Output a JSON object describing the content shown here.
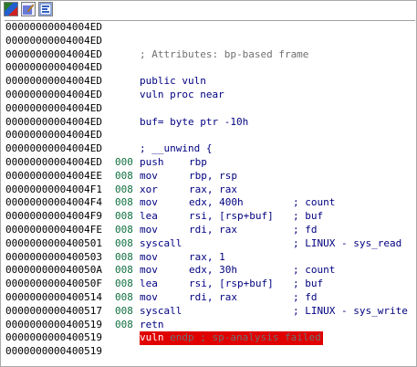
{
  "toolbar": {
    "buttons": [
      {
        "icon": "graph-view-icon"
      },
      {
        "icon": "edit-function-icon"
      },
      {
        "icon": "proximity-view-icon"
      }
    ]
  },
  "listing": [
    {
      "addr": "00000000004004ED"
    },
    {
      "addr": "00000000004004ED"
    },
    {
      "addr": "00000000004004ED",
      "text": "; Attributes: bp-based frame",
      "style": "gray"
    },
    {
      "addr": "00000000004004ED"
    },
    {
      "addr": "00000000004004ED",
      "text": "public vuln"
    },
    {
      "addr": "00000000004004ED",
      "text": "vuln proc near"
    },
    {
      "addr": "00000000004004ED"
    },
    {
      "addr": "00000000004004ED",
      "text": "buf= byte ptr -10h"
    },
    {
      "addr": "00000000004004ED"
    },
    {
      "addr": "00000000004004ED",
      "text": "; __unwind {"
    },
    {
      "addr": "00000000004004ED",
      "sp": "000",
      "mnem": "push",
      "ops": "rbp"
    },
    {
      "addr": "00000000004004EE",
      "sp": "008",
      "mnem": "mov",
      "ops": "rbp, rsp"
    },
    {
      "addr": "00000000004004F1",
      "sp": "008",
      "mnem": "xor",
      "ops": "rax, rax"
    },
    {
      "addr": "00000000004004F4",
      "sp": "008",
      "mnem": "mov",
      "ops": "edx, 400h",
      "comment": "; count"
    },
    {
      "addr": "00000000004004F9",
      "sp": "008",
      "mnem": "lea",
      "ops": "rsi, [rsp+buf]",
      "comment": "; buf"
    },
    {
      "addr": "00000000004004FE",
      "sp": "008",
      "mnem": "mov",
      "ops": "rdi, rax",
      "comment": "; fd"
    },
    {
      "addr": "0000000000400501",
      "sp": "008",
      "mnem": "syscall",
      "comment": "; LINUX - sys_read"
    },
    {
      "addr": "0000000000400503",
      "sp": "008",
      "mnem": "mov",
      "ops": "rax, 1"
    },
    {
      "addr": "000000000040050A",
      "sp": "008",
      "mnem": "mov",
      "ops": "edx, 30h",
      "comment": "; count"
    },
    {
      "addr": "000000000040050F",
      "sp": "008",
      "mnem": "lea",
      "ops": "rsi, [rsp+buf]",
      "comment": "; buf"
    },
    {
      "addr": "0000000000400514",
      "sp": "008",
      "mnem": "mov",
      "ops": "rdi, rax",
      "comment": "; fd"
    },
    {
      "addr": "0000000000400517",
      "sp": "008",
      "mnem": "syscall",
      "comment": "; LINUX - sys_write"
    },
    {
      "addr": "0000000000400519",
      "sp": "008",
      "mnem": "retn"
    },
    {
      "addr": "0000000000400519",
      "endp_name": "vuln",
      "endp_rest": " endp ; sp-analysis failed"
    },
    {
      "addr": "0000000000400519"
    }
  ],
  "colors": {
    "address": "#000000",
    "stack_pointer": "#107040",
    "instruction": "#000080",
    "comment_gray": "#707070",
    "error_highlight": "#e00000"
  }
}
